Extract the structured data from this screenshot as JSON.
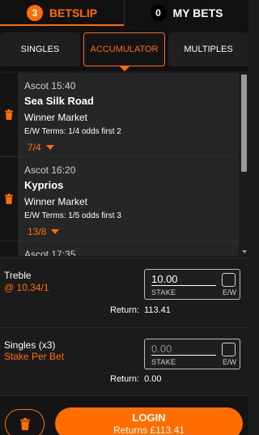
{
  "top_tabs": [
    {
      "label": "BETSLIP",
      "count": "3",
      "active": true
    },
    {
      "label": "MY BETS",
      "count": "0",
      "active": false
    }
  ],
  "bet_types": [
    {
      "label": "SINGLES",
      "active": false
    },
    {
      "label": "ACCUMULATOR",
      "active": true
    },
    {
      "label": "MULTIPLES",
      "active": false
    }
  ],
  "selections": [
    {
      "time": "Ascot 15:40",
      "name": "Sea Silk Road",
      "market": "Winner Market",
      "terms": "E/W Terms: 1/4 odds first 2",
      "odds": "7/4"
    },
    {
      "time": "Ascot 16:20",
      "name": "Kyprios",
      "market": "Winner Market",
      "terms": "E/W Terms: 1/5 odds first 3",
      "odds": "13/8"
    },
    {
      "time": "Ascot 17:35"
    }
  ],
  "treble": {
    "label": "Treble",
    "odds": "@ 10.34/1",
    "stake_value": "10.00",
    "stake_caption": "STAKE",
    "ew_caption": "E/W",
    "return_label": "Return:",
    "return_value": "113.41"
  },
  "singles": {
    "label": "Singles (x3)",
    "sub": "Stake Per Bet",
    "stake_placeholder": "0.00",
    "stake_caption": "STAKE",
    "ew_caption": "E/W",
    "return_label": "Return:",
    "return_value": "0.00"
  },
  "footer": {
    "login_label": "LOGIN",
    "returns_label": "Returns £113.41"
  },
  "colors": {
    "accent": "#ff6d00",
    "background": "#1b1b1b",
    "panel": "#262626"
  },
  "icons": {
    "delete": "trash-icon",
    "odds_dropdown": "caret-down-icon"
  }
}
